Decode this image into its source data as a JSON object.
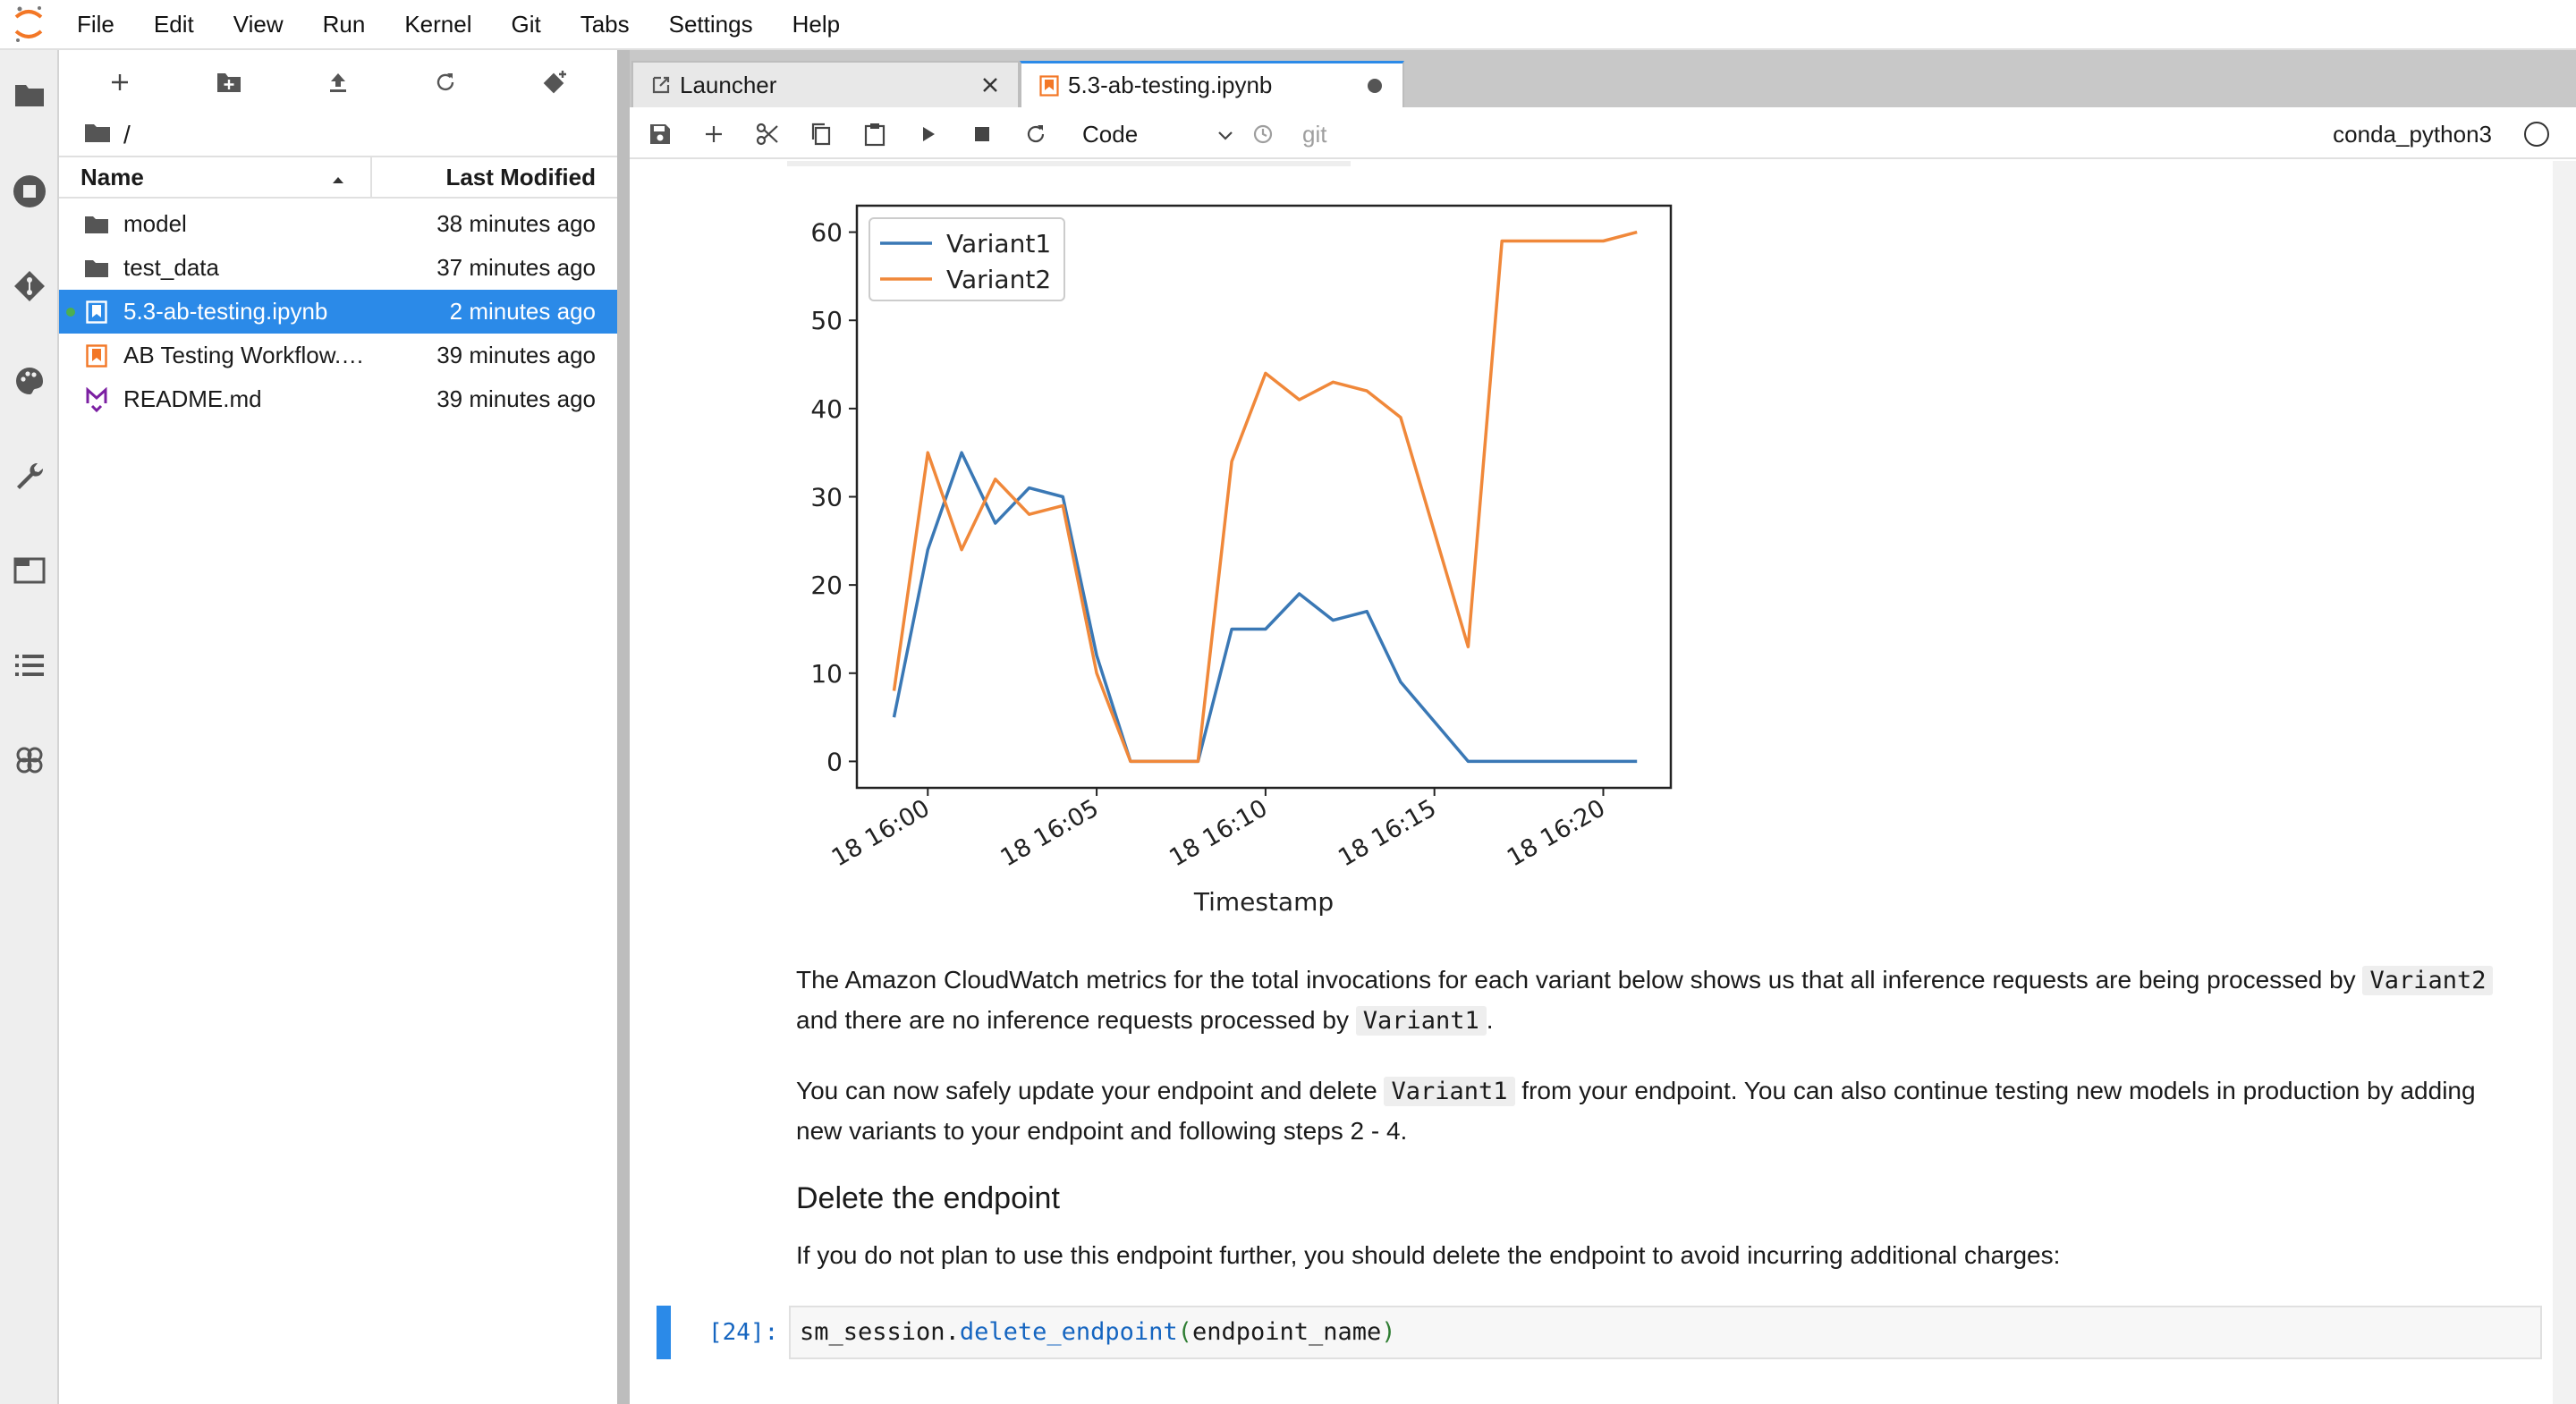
{
  "menubar": {
    "items": [
      "File",
      "Edit",
      "View",
      "Run",
      "Kernel",
      "Git",
      "Tabs",
      "Settings",
      "Help"
    ]
  },
  "activitybar": {
    "icons": [
      "folder-icon",
      "running-icon",
      "git-icon",
      "palette-icon",
      "wrench-icon",
      "tabs-icon",
      "toc-icon",
      "extension-icon"
    ]
  },
  "filebrowser": {
    "breadcrumb": "/",
    "columns": {
      "name": "Name",
      "modified": "Last Modified"
    },
    "files": [
      {
        "name": "model",
        "modified": "38 minutes ago",
        "type": "folder"
      },
      {
        "name": "test_data",
        "modified": "37 minutes ago",
        "type": "folder"
      },
      {
        "name": "5.3-ab-testing.ipynb",
        "modified": "2 minutes ago",
        "type": "notebook",
        "selected": true,
        "running": true
      },
      {
        "name": "AB Testing Workflow.…",
        "modified": "39 minutes ago",
        "type": "notebook"
      },
      {
        "name": "README.md",
        "modified": "39 minutes ago",
        "type": "markdown"
      }
    ]
  },
  "tabs": {
    "launcher": "Launcher",
    "notebook": "5.3-ab-testing.ipynb"
  },
  "toolbar": {
    "cell_type": "Code",
    "git": "git",
    "kernel": "conda_python3"
  },
  "chart_data": {
    "type": "line",
    "xlabel": "Timestamp",
    "x_ticks": [
      "18 16:00",
      "18 16:05",
      "18 16:10",
      "18 16:15",
      "18 16:20"
    ],
    "x_minutes": [
      -1,
      0,
      1,
      2,
      3,
      4,
      5,
      6,
      7,
      8,
      9,
      10,
      11,
      12,
      13,
      14,
      15,
      16,
      17,
      18,
      19,
      20,
      21
    ],
    "y_ticks": [
      "0",
      "10",
      "20",
      "30",
      "40",
      "50",
      "60"
    ],
    "ylim": [
      -3,
      63
    ],
    "xlim": [
      -2.1,
      22
    ],
    "legend": "top-left",
    "series": [
      {
        "name": "Variant1",
        "color": "#3a78b5",
        "values": [
          5,
          24,
          35,
          27,
          31,
          30,
          12,
          0,
          0,
          0,
          15,
          15,
          19,
          16,
          17,
          9,
          4.5,
          0,
          0,
          0,
          0,
          0,
          0
        ]
      },
      {
        "name": "Variant2",
        "color": "#f0883a",
        "values": [
          8,
          35,
          24,
          32,
          28,
          29,
          10,
          0,
          0,
          0,
          34,
          44,
          41,
          43,
          42,
          39,
          26,
          13,
          59,
          59,
          59,
          59,
          60
        ]
      }
    ]
  },
  "markdown": {
    "p1_a": "The Amazon CloudWatch metrics for the total invocations for each variant below shows us that all inference requests are being processed by",
    "p1_code1": "Variant2",
    "p1_b": "and there are no inference requests processed by",
    "p1_code2": "Variant1",
    "p1_c": ".",
    "p2_a": "You can now safely update your endpoint and delete",
    "p2_code": "Variant1",
    "p2_b": "from your endpoint. You can also continue testing new models in production by adding new variants to your endpoint and following steps 2 - 4.",
    "heading": "Delete the endpoint",
    "p3": "If you do not plan to use this endpoint further, you should delete the endpoint to avoid incurring additional charges:"
  },
  "code_cell": {
    "prompt": "[24]:",
    "obj": "sm_session",
    "dot": ".",
    "fn": "delete_endpoint",
    "open": "(",
    "arg": "endpoint_name",
    "close": ")"
  }
}
